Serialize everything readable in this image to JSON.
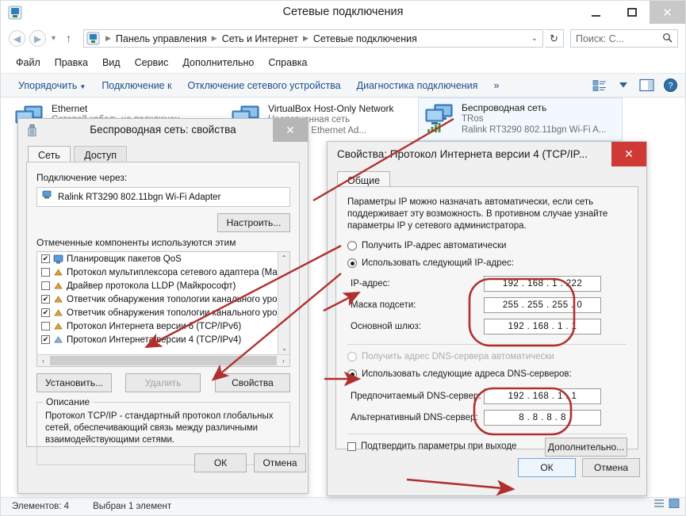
{
  "window": {
    "title": "Сетевые подключения",
    "icon": "network-connections-icon",
    "minimize_label": "—",
    "maximize_label": "▢",
    "close_label": "✕"
  },
  "nav": {
    "back_label": "◀",
    "forward_label": "▶",
    "recent_label": "▼",
    "up_label": "↑",
    "refresh_label": "↻",
    "address_chevron": "⌄",
    "breadcrumbs": [
      "Панель управления",
      "Сеть и Интернет",
      "Сетевые подключения"
    ],
    "crumb_separator": "▶"
  },
  "search": {
    "placeholder": "Поиск: С...",
    "icon": "search-icon"
  },
  "menubar": {
    "items": [
      "Файл",
      "Правка",
      "Вид",
      "Сервис",
      "Дополнительно",
      "Справка"
    ]
  },
  "commandbar": {
    "items": [
      {
        "label": "Упорядочить",
        "caret": "▼"
      },
      {
        "label": "Подключение к",
        "caret": ""
      },
      {
        "label": "Отключение сетевого устройства",
        "caret": ""
      },
      {
        "label": "Диагностика подключения",
        "caret": ""
      },
      {
        "label": "»",
        "caret": ""
      }
    ],
    "view_icon": "list-view-icon",
    "view_caret": "▼",
    "pane_icon": "preview-pane-icon",
    "help_icon": "help-icon"
  },
  "connections": [
    {
      "name": "Ethernet",
      "status": "Сетевой кабель не подключен",
      "adapter": "",
      "selected": false,
      "icon": "network-adapter-icon"
    },
    {
      "name": "VirtualBox Host-Only Network",
      "status": "Неопознанная сеть",
      "adapter": "Host-Only Ethernet Ad...",
      "selected": false,
      "icon": "network-adapter-icon"
    },
    {
      "name": "Беспроводная сеть",
      "status": "TRos",
      "adapter": "Ralink RT3290 802.11bgn Wi-Fi A...",
      "selected": true,
      "icon": "wireless-adapter-icon"
    }
  ],
  "statusbar": {
    "count_label": "Элементов: 4",
    "selection_label": "Выбран 1 элемент"
  },
  "wifi_dialog": {
    "title": "Беспроводная сеть: свойства",
    "icon": "nic-icon",
    "close_label": "✕",
    "tabs": [
      {
        "label": "Сеть",
        "active": true
      },
      {
        "label": "Доступ",
        "active": false
      }
    ],
    "connect_via_label": "Подключение через:",
    "adapter_name": "Ralink RT3290 802.11bgn Wi-Fi Adapter",
    "adapter_icon": "nic-small-icon",
    "configure_button": "Настроить...",
    "components_label": "Отмеченные компоненты используются этим подключением:",
    "components": [
      {
        "label": "Планировщик пакетов QoS",
        "checked": true,
        "icon": "monitor-icon"
      },
      {
        "label": "Протокол мультиплексора сетевого адаптера (Май",
        "checked": false,
        "icon": "protocol-icon"
      },
      {
        "label": "Драйвер протокола LLDP (Майкрософт)",
        "checked": false,
        "icon": "protocol-icon"
      },
      {
        "label": "Ответчик обнаружения топологии канального уров",
        "checked": true,
        "icon": "protocol-icon"
      },
      {
        "label": "Ответчик обнаружения топологии канального уров",
        "checked": true,
        "icon": "protocol-icon"
      },
      {
        "label": "Протокол Интернета версии 6 (TCP/IPv6)",
        "checked": false,
        "icon": "protocol-icon"
      },
      {
        "label": "Протокол Интернета версии 4 (TCP/IPv4)",
        "checked": true,
        "icon": "protocol-icon"
      }
    ],
    "buttons": {
      "install": "Установить...",
      "uninstall": "Удалить",
      "properties": "Свойства"
    },
    "description_title": "Описание",
    "description_text": "Протокол TCP/IP - стандартный протокол глобальных сетей, обеспечивающий связь между различными взаимодействующими сетями.",
    "ok": "ОК",
    "cancel": "Отмена",
    "scroll_up": "⌃",
    "scroll_down": "⌄",
    "scroll_left": "‹",
    "scroll_right": "›"
  },
  "ip_dialog": {
    "title": "Свойства: Протокол Интернета версии 4 (TCP/IP...",
    "close_label": "✕",
    "tab_label": "Общие",
    "intro_text": "Параметры IP можно назначать автоматически, если сеть поддерживает эту возможность. В противном случае узнайте параметры IP у сетевого администратора.",
    "auto_ip_label": "Получить IP-адрес автоматически",
    "manual_ip_label": "Использовать следующий IP-адрес:",
    "auto_ip_selected": false,
    "manual_ip_selected": true,
    "fields": [
      {
        "label": "IP-адрес:",
        "value": "192 . 168 .  1  . 222"
      },
      {
        "label": "Маска подсети:",
        "value": "255 . 255 . 255 .  0"
      },
      {
        "label": "Основной шлюз:",
        "value": "192 . 168 .  1  .  1"
      }
    ],
    "auto_dns_label": "Получить адрес DNS-сервера автоматически",
    "manual_dns_label": "Использовать следующие адреса DNS-серверов:",
    "auto_dns_selected": false,
    "manual_dns_selected": true,
    "dns_fields": [
      {
        "label": "Предпочитаемый DNS-сервер:",
        "value": "192 . 168 .  1  .  1"
      },
      {
        "label": "Альтернативный DNS-сервер:",
        "value": " 8  .  8  .  8  .  8"
      }
    ],
    "validate_label": "Подтвердить параметры при выходе",
    "validate_checked": false,
    "advanced_button": "Дополнительно...",
    "ok": "ОК",
    "cancel": "Отмена"
  },
  "annotations": {
    "color": "#b03030",
    "description": "red arrows and ellipses highlighting TCP/IPv4 item, Свойства button, IP radio, DNS radio, IP fields, DNS fields and OK button"
  }
}
